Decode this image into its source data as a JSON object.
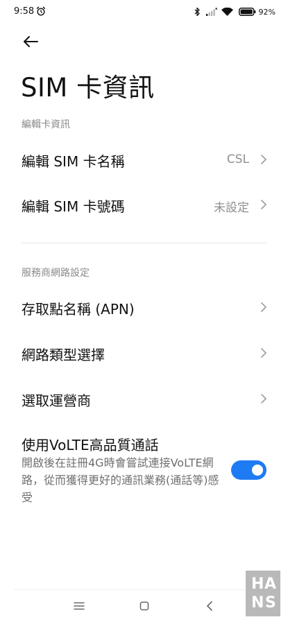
{
  "status_bar": {
    "time": "9:58",
    "battery": "92",
    "battery_suffix": "%",
    "icons": [
      "alarm-icon",
      "bluetooth-icon",
      "signal-icon",
      "wifi-icon",
      "battery-icon"
    ]
  },
  "header": {
    "back_icon": "arrow-left-icon",
    "title": "SIM 卡資訊"
  },
  "sections": {
    "card_info": {
      "header": "編輯卡資訊",
      "items": [
        {
          "label": "編輯 SIM 卡名稱",
          "value": "CSL"
        },
        {
          "label": "編輯 SIM 卡號碼",
          "value": "未設定"
        }
      ]
    },
    "network": {
      "header": "服務商網路設定",
      "items": [
        {
          "label": "存取點名稱 (APN)"
        },
        {
          "label": "網路類型選擇"
        },
        {
          "label": "選取運營商"
        }
      ]
    }
  },
  "volte": {
    "title": "使用VoLTE高品質通話",
    "description": "開啟後在註冊4G時會嘗試連接VoLTE網路，從而獲得更好的通訊業務(通話等)感受",
    "enabled": true
  },
  "watermark": {
    "letters": [
      "H",
      "A",
      "N",
      "S"
    ]
  },
  "colors": {
    "accent": "#1f7bf3",
    "text_primary": "#111111",
    "text_secondary": "#8a8a8a",
    "divider": "#e6e6e6"
  }
}
